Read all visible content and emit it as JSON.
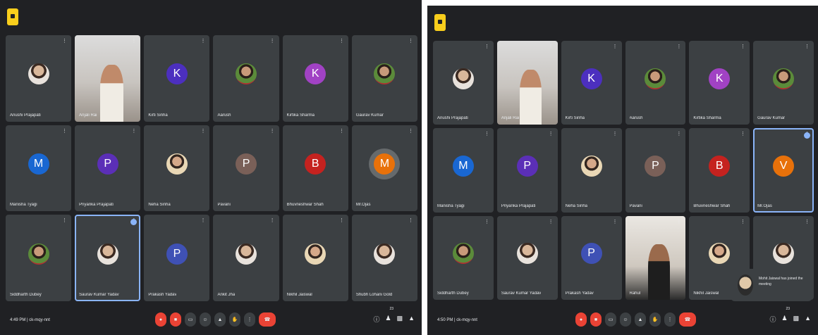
{
  "left": {
    "time": "4:49 PM",
    "meeting": "| ck-mqy-nnt",
    "participants": "23",
    "tiles": [
      {
        "name": "Anushi Prajapati",
        "initial": "",
        "color": "",
        "kind": "photo"
      },
      {
        "name": "Anjali Rai",
        "initial": "",
        "color": "",
        "kind": "video"
      },
      {
        "name": "Kirti Sinha",
        "initial": "K",
        "color": "#4c2fbf",
        "kind": "letter"
      },
      {
        "name": "Aarush",
        "initial": "",
        "color": "",
        "kind": "photo2"
      },
      {
        "name": "Kirtika Sharma",
        "initial": "K",
        "color": "#a142c4",
        "kind": "letter"
      },
      {
        "name": "Gaurav Kumar",
        "initial": "",
        "color": "",
        "kind": "photo2"
      },
      {
        "name": "Manisha Tyagi",
        "initial": "M",
        "color": "#1967d2",
        "kind": "letter"
      },
      {
        "name": "Priyanka Prajapati",
        "initial": "P",
        "color": "#5b2fb7",
        "kind": "letter"
      },
      {
        "name": "Neha Sinha",
        "initial": "",
        "color": "",
        "kind": "photo3"
      },
      {
        "name": "Pavani",
        "initial": "P",
        "color": "#7a6058",
        "kind": "letter"
      },
      {
        "name": "Bhuvneshwar Shah",
        "initial": "B",
        "color": "#c5221f",
        "kind": "letter"
      },
      {
        "name": "Mr.Ojas",
        "initial": "M",
        "color": "#e8710a",
        "kind": "letter-ring"
      },
      {
        "name": "Siddharth Dubey",
        "initial": "",
        "color": "",
        "kind": "photo2"
      },
      {
        "name": "Saurav Kumar Yadav",
        "initial": "",
        "color": "",
        "kind": "photo"
      },
      {
        "name": "Prakash Yadav",
        "initial": "P",
        "color": "#3f51b5",
        "kind": "letter"
      },
      {
        "name": "Ankit Jha",
        "initial": "",
        "color": "",
        "kind": "photo"
      },
      {
        "name": "Nikhil Jaiswal",
        "initial": "",
        "color": "",
        "kind": "photo3"
      },
      {
        "name": "Shubh Lohani Gold",
        "initial": "",
        "color": "",
        "kind": "photo"
      }
    ]
  },
  "right": {
    "time": "4:50 PM",
    "meeting": "| ck-mqy-nnt",
    "participants": "23",
    "toast_text": "Mohit Jaiswal has joined the meeting",
    "tiles": [
      {
        "name": "Anushi Prajapati",
        "initial": "",
        "color": "",
        "kind": "photo"
      },
      {
        "name": "Anjali Rai",
        "initial": "",
        "color": "",
        "kind": "video"
      },
      {
        "name": "Kirti Sinha",
        "initial": "K",
        "color": "#4c2fbf",
        "kind": "letter"
      },
      {
        "name": "Aarush",
        "initial": "",
        "color": "",
        "kind": "photo2"
      },
      {
        "name": "Kirtika Sharma",
        "initial": "K",
        "color": "#a142c4",
        "kind": "letter"
      },
      {
        "name": "Gaurav Kumar",
        "initial": "",
        "color": "",
        "kind": "photo2"
      },
      {
        "name": "Manisha Tyagi",
        "initial": "M",
        "color": "#1967d2",
        "kind": "letter"
      },
      {
        "name": "Priyanka Prajapati",
        "initial": "P",
        "color": "#5b2fb7",
        "kind": "letter"
      },
      {
        "name": "Neha Sinha",
        "initial": "",
        "color": "",
        "kind": "photo3"
      },
      {
        "name": "Pavani",
        "initial": "P",
        "color": "#7a6058",
        "kind": "letter"
      },
      {
        "name": "Bhuvneshwar Shah",
        "initial": "B",
        "color": "#c5221f",
        "kind": "letter"
      },
      {
        "name": "Mr.Ojas",
        "initial": "V",
        "color": "#e8710a",
        "kind": "letter"
      },
      {
        "name": "Siddharth Dubey",
        "initial": "",
        "color": "",
        "kind": "photo2"
      },
      {
        "name": "Saurav Kumar Yadav",
        "initial": "",
        "color": "",
        "kind": "photo"
      },
      {
        "name": "Prakash Yadav",
        "initial": "P",
        "color": "#3f51b5",
        "kind": "letter"
      },
      {
        "name": "Rahul",
        "initial": "",
        "color": "",
        "kind": "video-dark"
      },
      {
        "name": "Nikhil Jaiswal",
        "initial": "",
        "color": "",
        "kind": "photo3"
      },
      {
        "name": "Shubh Lohani Gold",
        "initial": "",
        "color": "",
        "kind": "photo"
      }
    ]
  },
  "controls": [
    "mic",
    "cam",
    "cc",
    "emoji",
    "present",
    "raise",
    "more"
  ],
  "right_icons": [
    "info",
    "people",
    "chat",
    "activities"
  ]
}
